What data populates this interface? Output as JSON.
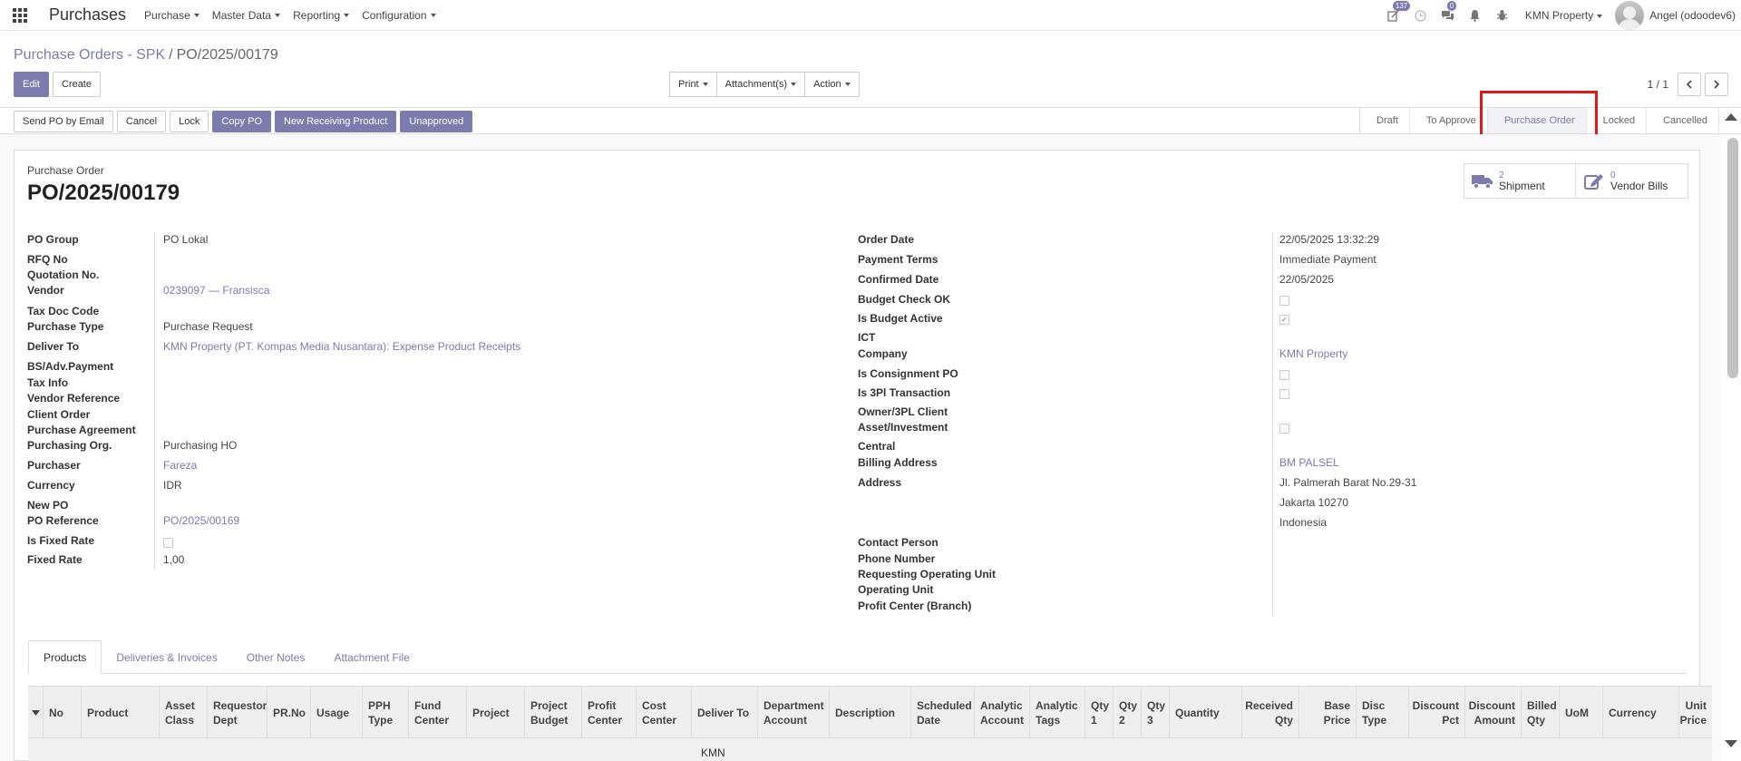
{
  "navbar": {
    "app_title": "Purchases",
    "menus": [
      "Purchase",
      "Master Data",
      "Reporting",
      "Configuration"
    ],
    "activity_count": "137",
    "messages_count": "0",
    "company": "KMN Property",
    "user": "Angel (odoodev6)"
  },
  "breadcrumb": {
    "parent": "Purchase Orders - SPK",
    "separator": "/",
    "current": "PO/2025/00179"
  },
  "control_panel": {
    "edit_label": "Edit",
    "create_label": "Create",
    "print_label": "Print",
    "attachments_label": "Attachment(s)",
    "action_label": "Action",
    "pager_value": "1 / 1"
  },
  "statusbar": {
    "buttons": {
      "send_email": "Send PO by Email",
      "cancel": "Cancel",
      "lock": "Lock",
      "copy_po": "Copy PO",
      "new_receiving": "New Receiving Product",
      "unapproved": "Unapproved"
    },
    "stages": {
      "draft": "Draft",
      "to_approve": "To Approve",
      "purchase_order": "Purchase Order",
      "locked": "Locked",
      "cancelled": "Cancelled"
    },
    "active_stage": "Purchase Order"
  },
  "sheet": {
    "title_label": "Purchase Order",
    "title": "PO/2025/00179",
    "smart_buttons": {
      "shipment": {
        "count": "2",
        "label": "Shipment"
      },
      "vendor_bills": {
        "count": "0",
        "label": "Vendor Bills"
      }
    },
    "left": {
      "po_group": {
        "label": "PO Group",
        "value": "PO Lokal"
      },
      "rfq_no": {
        "label": "RFQ No"
      },
      "quotation_no": {
        "label": "Quotation No."
      },
      "vendor": {
        "label": "Vendor",
        "value": "0239097 — Fransisca"
      },
      "tax_doc_code": {
        "label": "Tax Doc Code"
      },
      "purchase_type": {
        "label": "Purchase Type",
        "value": "Purchase Request"
      },
      "deliver_to": {
        "label": "Deliver To",
        "value": "KMN Property (PT. Kompas Media Nusantara): Expense Product Receipts"
      },
      "bs_adv_payment": {
        "label": "BS/Adv.Payment"
      },
      "tax_info": {
        "label": "Tax Info"
      },
      "vendor_reference": {
        "label": "Vendor Reference"
      },
      "client_order": {
        "label": "Client Order"
      },
      "purchase_agreement": {
        "label": "Purchase Agreement"
      },
      "purchasing_org": {
        "label": "Purchasing Org.",
        "value": "Purchasing HO"
      },
      "purchaser": {
        "label": "Purchaser",
        "value": "Fareza"
      },
      "currency": {
        "label": "Currency",
        "value": "IDR"
      },
      "new_po": {
        "label": "New PO"
      },
      "po_reference": {
        "label": "PO Reference",
        "value": "PO/2025/00169"
      },
      "is_fixed_rate": {
        "label": "Is Fixed Rate",
        "checked": false
      },
      "fixed_rate": {
        "label": "Fixed Rate",
        "value": "1,00"
      }
    },
    "right": {
      "order_date": {
        "label": "Order Date",
        "value": "22/05/2025 13:32:29"
      },
      "payment_terms": {
        "label": "Payment Terms",
        "value": "Immediate Payment"
      },
      "confirmed_date": {
        "label": "Confirmed Date",
        "value": "22/05/2025"
      },
      "budget_check_ok": {
        "label": "Budget Check OK",
        "checked": false
      },
      "is_budget_active": {
        "label": "Is Budget Active",
        "checked": true
      },
      "ict": {
        "label": "ICT"
      },
      "company": {
        "label": "Company",
        "value": "KMN Property"
      },
      "is_consignment_po": {
        "label": "Is Consignment PO",
        "checked": false
      },
      "is_3pl_transaction": {
        "label": "Is 3Pl Transaction",
        "checked": false
      },
      "owner_3pl_client": {
        "label": "Owner/3PL Client"
      },
      "asset_investment": {
        "label": "Asset/Investment",
        "checked": false
      },
      "central": {
        "label": "Central"
      },
      "billing_address": {
        "label": "Billing Address",
        "value": "BM PALSEL"
      },
      "address": {
        "label": "Address",
        "line1": "Jl. Palmerah Barat No.29-31",
        "line2": "Jakarta  10270",
        "line3": "Indonesia"
      },
      "contact_person": {
        "label": "Contact Person"
      },
      "phone_number": {
        "label": "Phone Number"
      },
      "requesting_operating_unit": {
        "label": "Requesting Operating Unit"
      },
      "operating_unit": {
        "label": "Operating Unit"
      },
      "profit_center": {
        "label": "Profit Center (Branch)"
      }
    }
  },
  "notebook": {
    "tabs": [
      "Products",
      "Deliveries & Invoices",
      "Other Notes",
      "Attachment File"
    ],
    "active_tab": "Products",
    "columns": {
      "no": "No",
      "product": "Product",
      "asset_class": "Asset Class",
      "requestor_dept": "Requestor Dept",
      "pr_no": "PR.No",
      "usage": "Usage",
      "pph_type": "PPH Type",
      "fund_center": "Fund Center",
      "project": "Project",
      "project_budget": "Project Budget",
      "profit_center": "Profit Center",
      "cost_center": "Cost Center",
      "deliver_to": "Deliver To",
      "department_account": "Department Account",
      "description": "Description",
      "scheduled_date": "Scheduled Date",
      "analytic_account": "Analytic Account",
      "analytic_tags": "Analytic Tags",
      "qty1": "Qty 1",
      "qty2": "Qty 2",
      "qty3": "Qty 3",
      "quantity": "Quantity",
      "received_qty": "Received Qty",
      "base_price": "Base Price",
      "disc_type": "Disc Type",
      "discount_pct": "Discount Pct",
      "discount_amount": "Discount Amount",
      "billed_qty": "Billed Qty",
      "uom": "UoM",
      "currency": "Currency",
      "unit_price": "Unit Price"
    },
    "first_row_deliver_to": "KMN"
  }
}
